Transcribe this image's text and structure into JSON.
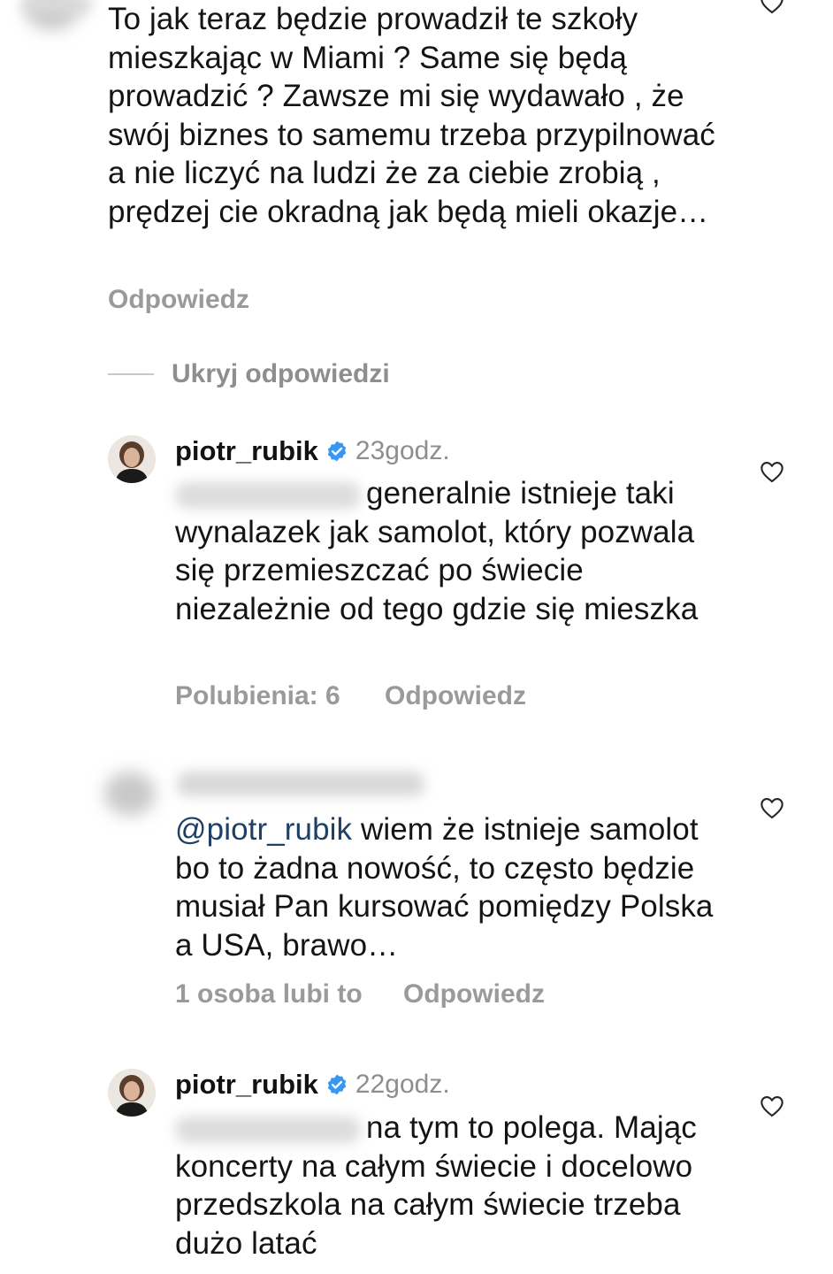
{
  "comments": [
    {
      "text": "To jak teraz będzie prowadził te szkoły mieszkając w Miami ? Same się będą prowadzić ? Zawsze mi się wydawało , że swój biznes to samemu trzeba przypilnować a nie liczyć na ludzi że za ciebie zrobią , prędzej cie okradną jak będą mieli okazje…",
      "reply_label": "Odpowiedz"
    }
  ],
  "hide_replies_label": "Ukryj odpowiedzi",
  "replies": [
    {
      "username": "piotr_rubik",
      "time": "23godz.",
      "text": "generalnie istnieje taki wynalazek jak samolot, który pozwala się przemieszczać po świecie niezależnie od tego gdzie się mieszka",
      "likes_label": "Polubienia: 6",
      "reply_label": "Odpowiedz"
    },
    {
      "mention": "@piotr_rubik",
      "text": " wiem że istnieje samolot bo to żadna nowość, to często będzie musiał Pan kursować pomiędzy Polska a USA, brawo…",
      "likes_label": "1 osoba lubi to",
      "reply_label": "Odpowiedz"
    },
    {
      "username": "piotr_rubik",
      "time": "22godz.",
      "text": "na tym to polega. Mając koncerty na całym świecie i docelowo przedszkola na całym świecie trzeba dużo latać"
    }
  ],
  "icons": {
    "heart": "heart-outline-icon",
    "verified": "verified-badge-icon"
  },
  "colors": {
    "text": "#141414",
    "secondary": "#9a9a9a",
    "mention": "#1e3f66",
    "verified": "#3897f0"
  }
}
